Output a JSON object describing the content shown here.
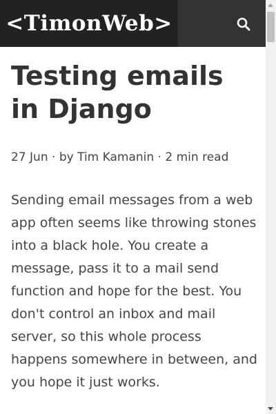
{
  "header": {
    "logo_text": "<TimonWeb>",
    "search_icon": "search-icon"
  },
  "article": {
    "title": "Testing emails in Django",
    "meta": {
      "date": "27 Jun",
      "by": "by",
      "author": "Tim Kamanin",
      "read_time": "2 min read",
      "separator": "·"
    },
    "paragraphs": [
      "Sending email messages from a web app often seems like throwing stones into a black hole. You create a message, pass it to a mail send function and hope for the best. You don't control an inbox and mail server, so this whole process happens somewhere in between, and you hope it just works."
    ]
  },
  "colors": {
    "header_bg": "#2d2d2d",
    "logo_bg": "#222222",
    "text": "#333333"
  }
}
